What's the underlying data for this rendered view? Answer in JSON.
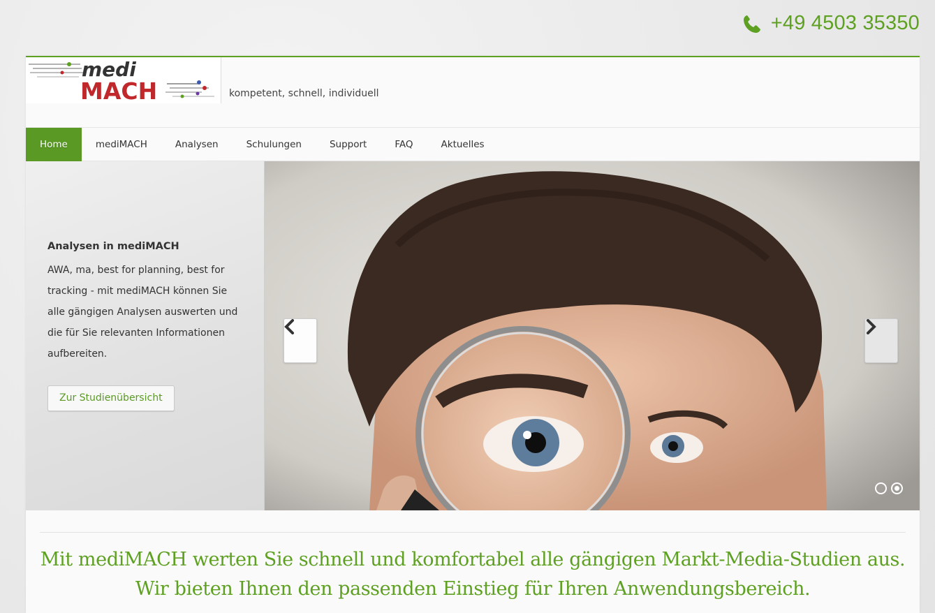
{
  "contact": {
    "phone": "+49 4503 35350",
    "icon": "phone-icon"
  },
  "header": {
    "logo": {
      "line1": "medi",
      "line2": "MACH"
    },
    "tagline": "kompetent, schnell, individuell"
  },
  "nav": {
    "items": [
      {
        "label": "Home",
        "active": true
      },
      {
        "label": "mediMACH",
        "active": false
      },
      {
        "label": "Analysen",
        "active": false
      },
      {
        "label": "Schulungen",
        "active": false
      },
      {
        "label": "Support",
        "active": false
      },
      {
        "label": "FAQ",
        "active": false
      },
      {
        "label": "Aktuelles",
        "active": false
      }
    ]
  },
  "slider": {
    "title": "Analysen in mediMACH",
    "body": "AWA, ma, best for planning, best for tracking - mit mediMACH können Sie alle gängigen Analysen auswerten und die für Sie relevanten Informationen aufbereiten.",
    "button_label": "Zur Studienübersicht",
    "prev_icon": "chevron-left-icon",
    "next_icon": "chevron-right-icon",
    "slide_count": 2,
    "current_slide": 2
  },
  "intro": {
    "text": "Mit mediMACH werten Sie schnell und komfortabel alle gängigen Markt-Media-Studien aus. Wir bieten Ihnen den passenden Einstieg für Ihren Anwendungsbereich."
  },
  "colors": {
    "brand_green": "#5ea022",
    "logo_red": "#c0282c"
  }
}
